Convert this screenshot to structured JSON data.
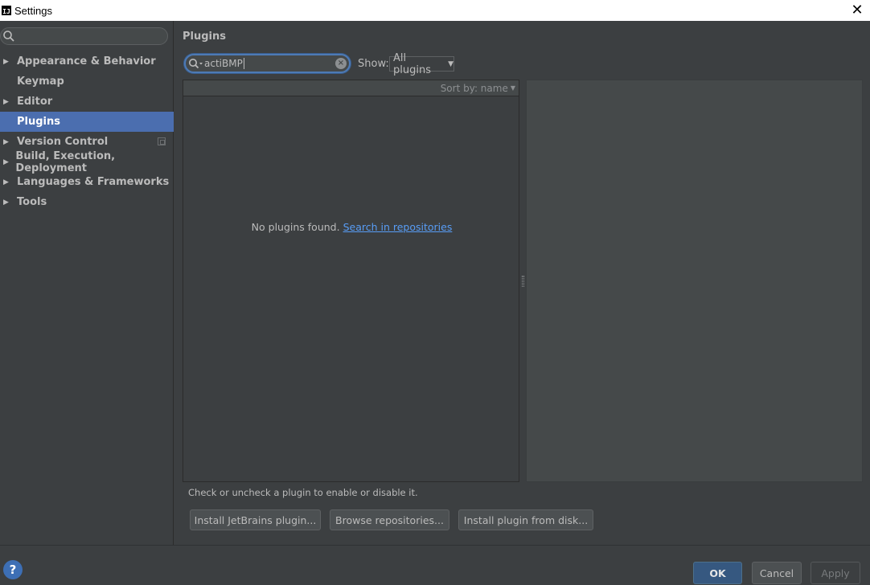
{
  "window": {
    "title": "Settings",
    "app_icon_text": "IJ"
  },
  "sidebar": {
    "search_value": "",
    "items": [
      {
        "label": "Appearance & Behavior",
        "expandable": true
      },
      {
        "label": "Keymap",
        "expandable": false
      },
      {
        "label": "Editor",
        "expandable": true
      },
      {
        "label": "Plugins",
        "expandable": false,
        "selected": true
      },
      {
        "label": "Version Control",
        "expandable": true
      },
      {
        "label": "Build, Execution, Deployment",
        "expandable": true
      },
      {
        "label": "Languages & Frameworks",
        "expandable": true
      },
      {
        "label": "Tools",
        "expandable": true
      }
    ]
  },
  "plugins": {
    "heading": "Plugins",
    "search_value": "actiBMP",
    "show_label": "Show:",
    "show_selected": "All plugins",
    "sort_label": "Sort by: name",
    "empty_text": "No plugins found.",
    "empty_link": "Search in repositories",
    "hint": "Check or uncheck a plugin to enable or disable it.",
    "buttons": {
      "install_jetbrains": "Install JetBrains plugin...",
      "browse_repos": "Browse repositories...",
      "install_disk": "Install plugin from disk..."
    }
  },
  "footer": {
    "help": "?",
    "ok": "OK",
    "cancel": "Cancel",
    "apply": "Apply"
  },
  "colors": {
    "background": "#3c3f41",
    "selection": "#4b6eaf",
    "link": "#589df6",
    "ok_button": "#365880",
    "help_icon": "#3d6fb5"
  }
}
